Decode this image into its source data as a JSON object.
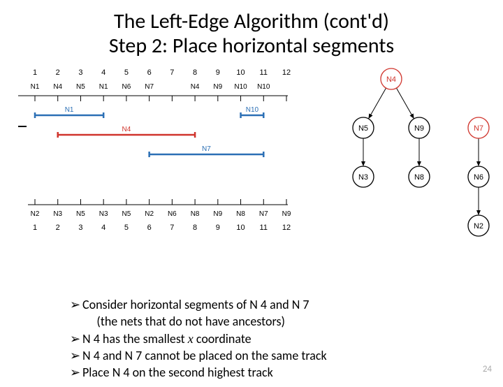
{
  "title_line1": "The Left-Edge Algorithm (cont'd)",
  "title_line2": "Step 2: Place horizontal segments",
  "bullets": {
    "b1": "Consider horizontal segments of N 4 and N 7",
    "b1_sub": "(the nets that do not have ancestors)",
    "b2_pre": "N 4 has the smallest ",
    "b2_x": "x",
    "b2_post": " coordinate",
    "b3": "N 4 and N 7 cannot be placed on the same track",
    "b4": "Place N 4 on the second highest track"
  },
  "bullet_glyph": "➢",
  "page_number": "24",
  "chart_data": {
    "type": "diagram",
    "columns": [
      1,
      2,
      3,
      4,
      5,
      6,
      7,
      8,
      9,
      10,
      11,
      12
    ],
    "top_nets": [
      "N1",
      "N4",
      "N5",
      "N1",
      "N6",
      "N7",
      "",
      "N4",
      "N9",
      "N10",
      "N10",
      ""
    ],
    "bottom_nets": [
      "N2",
      "N3",
      "N5",
      "N3",
      "N5",
      "N2",
      "N6",
      "N8",
      "N9",
      "N8",
      "N7",
      "N9"
    ],
    "tracks": [
      {
        "label": "N1",
        "color": "#2b6fb5",
        "row": 1,
        "from": 1,
        "to": 4
      },
      {
        "label": "N10",
        "color": "#2b6fb5",
        "row": 1,
        "from": 10,
        "to": 11
      },
      {
        "label": "N4",
        "color": "#d0342c",
        "row": 2,
        "from": 2,
        "to": 8
      },
      {
        "label": "N7",
        "color": "#2b6fb5",
        "row": 3,
        "from": 6,
        "to": 11
      }
    ],
    "vcg": {
      "nodes": [
        {
          "id": "N4",
          "color": "#d0342c"
        },
        {
          "id": "N5",
          "color": "#000"
        },
        {
          "id": "N9",
          "color": "#000"
        },
        {
          "id": "N3",
          "color": "#000"
        },
        {
          "id": "N8",
          "color": "#000"
        },
        {
          "id": "N7",
          "color": "#d0342c"
        },
        {
          "id": "N6",
          "color": "#000"
        },
        {
          "id": "N2",
          "color": "#000"
        }
      ],
      "edges": [
        [
          "N4",
          "N5"
        ],
        [
          "N4",
          "N9"
        ],
        [
          "N5",
          "N3"
        ],
        [
          "N9",
          "N8"
        ],
        [
          "N7",
          "N6"
        ],
        [
          "N6",
          "N2"
        ]
      ]
    }
  }
}
